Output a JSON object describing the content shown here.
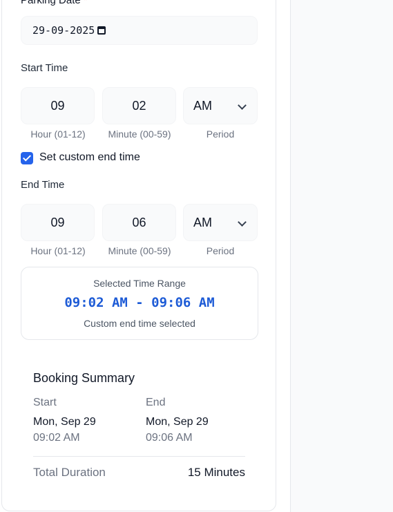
{
  "form": {
    "date_label": "Parking Date",
    "date_required_mark": "*",
    "date_value": "29-09-2025",
    "start_time": {
      "label": "Start Time",
      "hour": "09",
      "minute": "02",
      "period": "AM",
      "hour_hint": "Hour (01-12)",
      "minute_hint": "Minute (00-59)",
      "period_hint": "Period"
    },
    "custom_end": {
      "checked": true,
      "label": "Set custom end time"
    },
    "end_time": {
      "label": "End Time",
      "hour": "09",
      "minute": "06",
      "period": "AM",
      "hour_hint": "Hour (01-12)",
      "minute_hint": "Minute (00-59)",
      "period_hint": "Period"
    },
    "range": {
      "title": "Selected Time Range",
      "value": "09:02 AM - 09:06 AM",
      "note": "Custom end time selected"
    }
  },
  "summary": {
    "title": "Booking Summary",
    "start_label": "Start",
    "start_date": "Mon, Sep 29",
    "start_time": "09:02 AM",
    "end_label": "End",
    "end_date": "Mon, Sep 29",
    "end_time": "09:06 AM",
    "total_label": "Total Duration",
    "total_value": "15 Minutes"
  },
  "colors": {
    "accent": "#2563eb",
    "range_text": "#1d5bd6",
    "required": "#ef4444"
  },
  "icons": {
    "date_picker": "calendar-icon",
    "period_dropdown": "chevron-down-icon",
    "checkbox": "check-icon"
  }
}
